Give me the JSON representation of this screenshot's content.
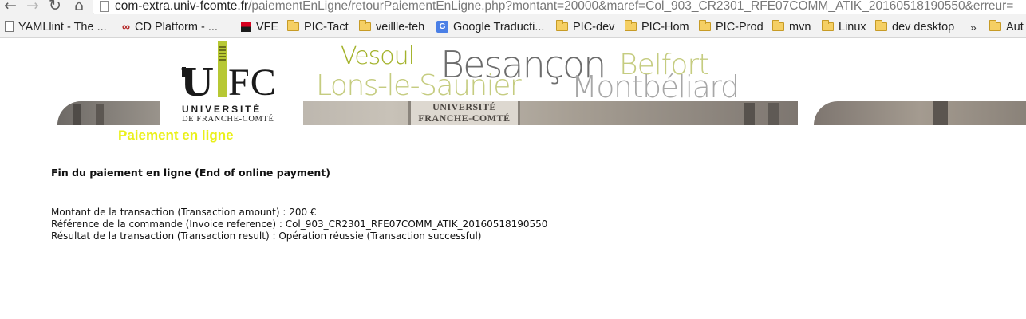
{
  "browser": {
    "url_host": "com-extra.univ-fcomte.fr",
    "url_path": "/paiementEnLigne/retourPaiementEnLigne.php?montant=20000&maref=Col_903_CR2301_RFE07COMM_ATIK_20160518190550&erreur=",
    "bookmarks": [
      {
        "label": "YAMLlint - The ...",
        "icon": "page-icon"
      },
      {
        "label": "CD Platform - ...",
        "icon": "infinity-icon"
      },
      {
        "label": "VFE",
        "icon": "vfe-icon"
      },
      {
        "label": "PIC-Tact",
        "icon": "folder-icon"
      },
      {
        "label": "veillle-teh",
        "icon": "folder-icon"
      },
      {
        "label": "Google Traducti...",
        "icon": "google-translate-icon"
      },
      {
        "label": "PIC-dev",
        "icon": "folder-icon"
      },
      {
        "label": "PIC-Hom",
        "icon": "folder-icon"
      },
      {
        "label": "PIC-Prod",
        "icon": "folder-icon"
      },
      {
        "label": "mvn",
        "icon": "folder-icon"
      },
      {
        "label": "Linux",
        "icon": "folder-icon"
      },
      {
        "label": "dev desktop",
        "icon": "folder-icon"
      }
    ],
    "bookmarks_overflow": "»",
    "bookmarks_last": "Aut"
  },
  "header": {
    "logo_u": "U",
    "logo_fc": "FC",
    "logo_line1": "UNIVERSITÉ",
    "logo_line2": "DE FRANCHE-COMTÉ",
    "sign_line1": "UNIVERSITÉ",
    "sign_line2": "FRANCHE-COMTÉ",
    "cities": {
      "vesoul": "Vesoul",
      "besancon": "Besançon",
      "belfort": "Belfort",
      "lons": "Lons-le-Saunier",
      "montbeliard": "Montbéliard"
    },
    "colors": {
      "accent_green": "#a3b22a",
      "title_yellow": "#eaf01a"
    }
  },
  "page": {
    "section_title": "Paiement en ligne",
    "heading": "Fin du paiement en ligne (End of online payment)",
    "amount_label": "Montant de la transaction (Transaction amount) : ",
    "amount_value": "200 €",
    "reference_label": "Référence de la commande (Invoice reference) : ",
    "reference_value": "Col_903_CR2301_RFE07COMM_ATIK_20160518190550",
    "result_label": "Résultat de la transaction (Transaction result) : ",
    "result_value": " Opération réussie (Transaction successful)"
  }
}
